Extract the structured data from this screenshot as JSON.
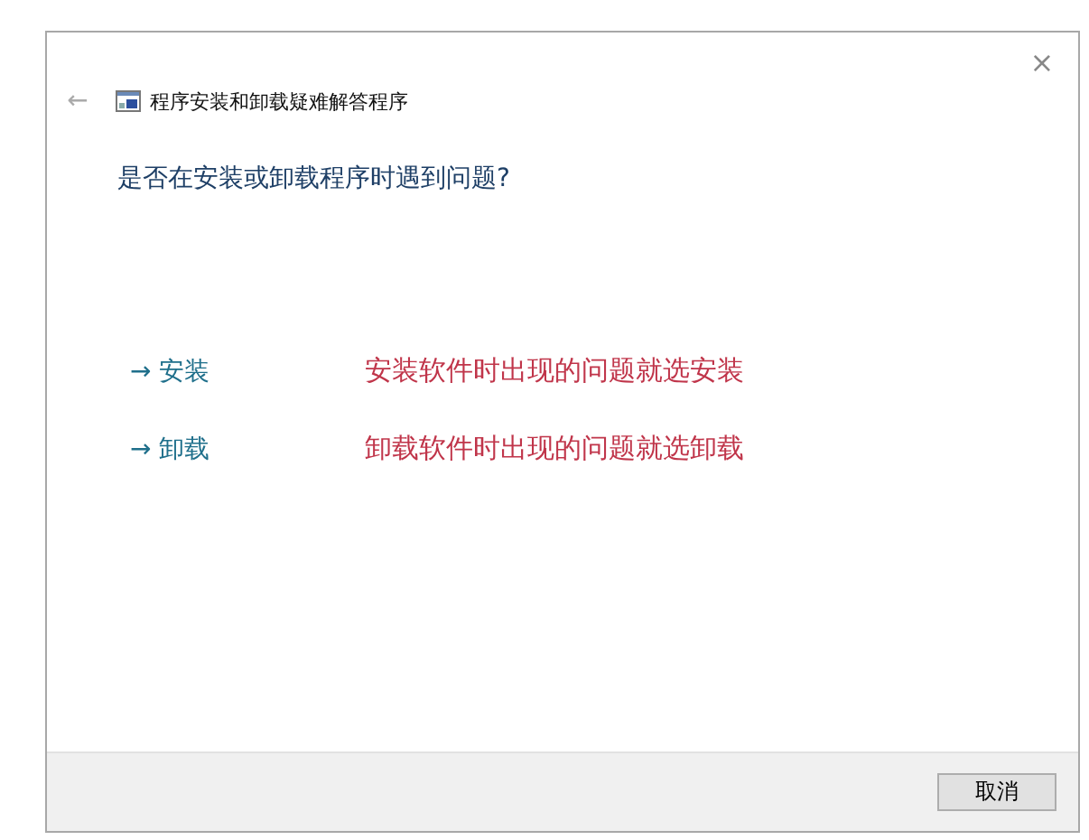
{
  "window": {
    "title": "程序安装和卸载疑难解答程序",
    "close": "×",
    "back": "←"
  },
  "heading": "是否在安装或卸载程序时遇到问题?",
  "options": [
    {
      "arrow": "→",
      "label": "安装",
      "note": "安装软件时出现的问题就选安装"
    },
    {
      "arrow": "→",
      "label": "卸载",
      "note": "卸载软件时出现的问题就选卸载"
    }
  ],
  "buttons": [
    "取消"
  ]
}
